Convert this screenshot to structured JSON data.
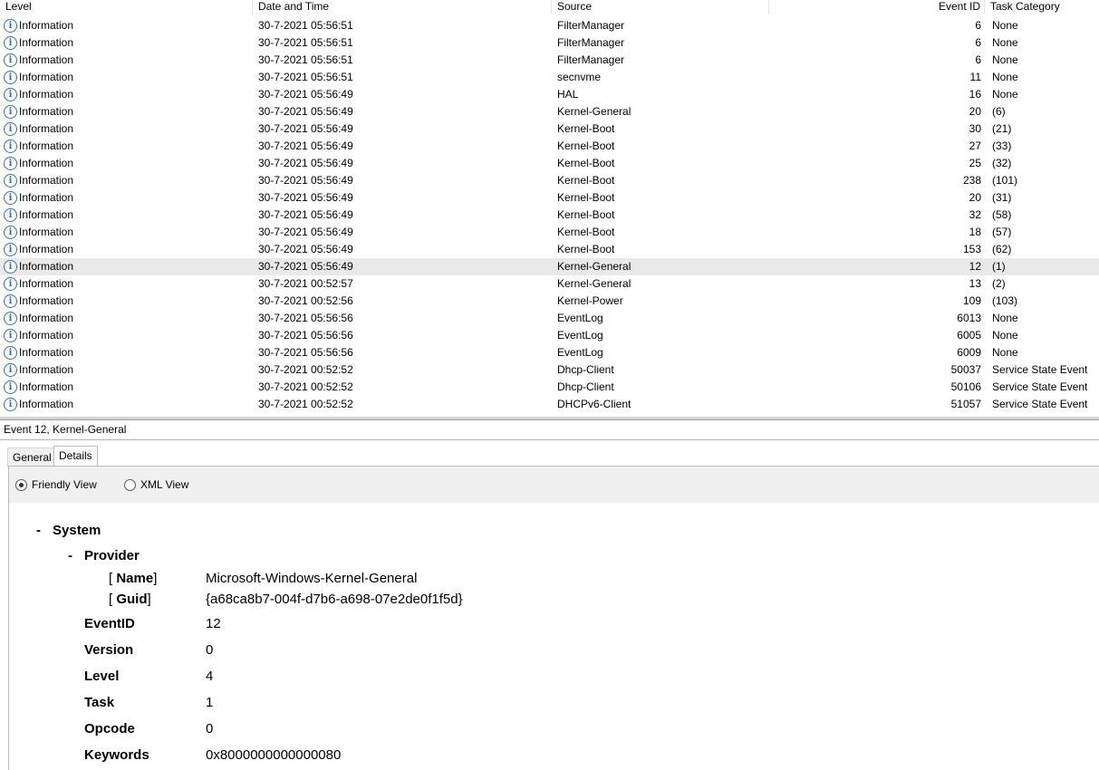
{
  "columns": {
    "level": "Level",
    "date": "Date and Time",
    "source": "Source",
    "event_id": "Event ID",
    "task": "Task Category"
  },
  "rows": [
    {
      "level": "Information",
      "date": "30-7-2021 05:56:51",
      "source": "FilterManager",
      "id": "6",
      "task": "None"
    },
    {
      "level": "Information",
      "date": "30-7-2021 05:56:51",
      "source": "FilterManager",
      "id": "6",
      "task": "None"
    },
    {
      "level": "Information",
      "date": "30-7-2021 05:56:51",
      "source": "FilterManager",
      "id": "6",
      "task": "None"
    },
    {
      "level": "Information",
      "date": "30-7-2021 05:56:51",
      "source": "secnvme",
      "id": "11",
      "task": "None"
    },
    {
      "level": "Information",
      "date": "30-7-2021 05:56:49",
      "source": "HAL",
      "id": "16",
      "task": "None"
    },
    {
      "level": "Information",
      "date": "30-7-2021 05:56:49",
      "source": "Kernel-General",
      "id": "20",
      "task": "(6)"
    },
    {
      "level": "Information",
      "date": "30-7-2021 05:56:49",
      "source": "Kernel-Boot",
      "id": "30",
      "task": "(21)"
    },
    {
      "level": "Information",
      "date": "30-7-2021 05:56:49",
      "source": "Kernel-Boot",
      "id": "27",
      "task": "(33)"
    },
    {
      "level": "Information",
      "date": "30-7-2021 05:56:49",
      "source": "Kernel-Boot",
      "id": "25",
      "task": "(32)"
    },
    {
      "level": "Information",
      "date": "30-7-2021 05:56:49",
      "source": "Kernel-Boot",
      "id": "238",
      "task": "(101)"
    },
    {
      "level": "Information",
      "date": "30-7-2021 05:56:49",
      "source": "Kernel-Boot",
      "id": "20",
      "task": "(31)"
    },
    {
      "level": "Information",
      "date": "30-7-2021 05:56:49",
      "source": "Kernel-Boot",
      "id": "32",
      "task": "(58)"
    },
    {
      "level": "Information",
      "date": "30-7-2021 05:56:49",
      "source": "Kernel-Boot",
      "id": "18",
      "task": "(57)"
    },
    {
      "level": "Information",
      "date": "30-7-2021 05:56:49",
      "source": "Kernel-Boot",
      "id": "153",
      "task": "(62)"
    },
    {
      "level": "Information",
      "date": "30-7-2021 05:56:49",
      "source": "Kernel-General",
      "id": "12",
      "task": "(1)",
      "selected": true
    },
    {
      "level": "Information",
      "date": "30-7-2021 00:52:57",
      "source": "Kernel-General",
      "id": "13",
      "task": "(2)"
    },
    {
      "level": "Information",
      "date": "30-7-2021 00:52:56",
      "source": "Kernel-Power",
      "id": "109",
      "task": "(103)"
    },
    {
      "level": "Information",
      "date": "30-7-2021 05:56:56",
      "source": "EventLog",
      "id": "6013",
      "task": "None"
    },
    {
      "level": "Information",
      "date": "30-7-2021 05:56:56",
      "source": "EventLog",
      "id": "6005",
      "task": "None"
    },
    {
      "level": "Information",
      "date": "30-7-2021 05:56:56",
      "source": "EventLog",
      "id": "6009",
      "task": "None"
    },
    {
      "level": "Information",
      "date": "30-7-2021 00:52:52",
      "source": "Dhcp-Client",
      "id": "50037",
      "task": "Service State Event"
    },
    {
      "level": "Information",
      "date": "30-7-2021 00:52:52",
      "source": "Dhcp-Client",
      "id": "50106",
      "task": "Service State Event"
    },
    {
      "level": "Information",
      "date": "30-7-2021 00:52:52",
      "source": "DHCPv6-Client",
      "id": "51057",
      "task": "Service State Event"
    }
  ],
  "row_icon": "information-icon",
  "detail": {
    "title": "Event 12, Kernel-General",
    "tabs": [
      "General",
      "Details"
    ],
    "active_tab": "Details",
    "radio_friendly": "Friendly View",
    "radio_xml": "XML View",
    "selected_view": "Friendly View",
    "system_toggle": "-",
    "system_label": "System",
    "provider_toggle": "-",
    "provider_label": "Provider",
    "bracket_open": "[",
    "bracket_close": "]",
    "name_key": "Name",
    "name_value": "Microsoft-Windows-Kernel-General",
    "guid_key": "Guid",
    "guid_value": "{a68ca8b7-004f-d7b6-a698-07e2de0f1f5d}",
    "fields": [
      {
        "key": "EventID",
        "value": "12"
      },
      {
        "key": "Version",
        "value": "0"
      },
      {
        "key": "Level",
        "value": "4"
      },
      {
        "key": "Task",
        "value": "1"
      },
      {
        "key": "Opcode",
        "value": "0"
      },
      {
        "key": "Keywords",
        "value": "0x8000000000000080"
      }
    ]
  },
  "colors": {
    "selected_row": "#e9e9e9",
    "info_icon": "#3a6ea8",
    "radio_bar": "#f0f0f0"
  }
}
